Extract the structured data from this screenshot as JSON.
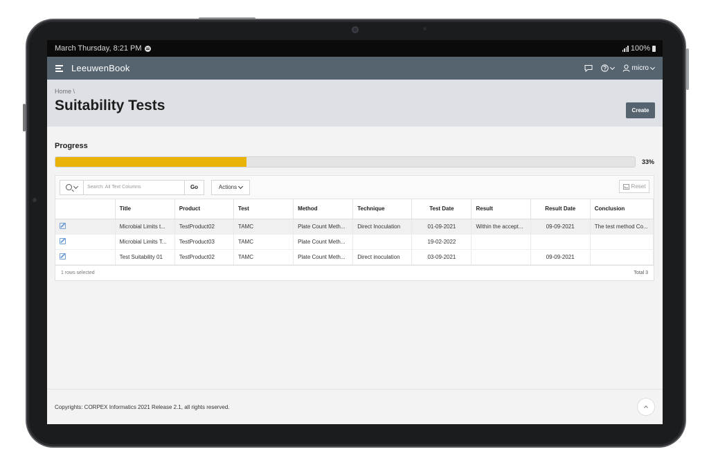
{
  "status_bar": {
    "datetime": "March Thursday, 8:21 PM",
    "battery": "100%"
  },
  "app": {
    "name": "LeeuwenBook",
    "user": "micro"
  },
  "breadcrumb": "Home \\",
  "page_title": "Suitability Tests",
  "create_label": "Create",
  "progress": {
    "label": "Progress",
    "percent_text": "33%",
    "value": 0.33,
    "bar_color": "#eab308"
  },
  "report": {
    "search_placeholder": "Search: All Text Columns",
    "go_label": "Go",
    "actions_label": "Actions",
    "reset_label": "Reset",
    "columns": [
      "Title",
      "Product",
      "Test",
      "Method",
      "Technique",
      "Test Date",
      "Result",
      "Result Date",
      "Conclusion"
    ],
    "rows": [
      [
        "Microbial Limits t...",
        "TestProduct02",
        "TAMC",
        "Plate Count Meth...",
        "Direct Inoculation",
        "01-09-2021",
        "Within the accept...",
        "09-09-2021",
        "The test method Co..."
      ],
      [
        "Microbial Limits T...",
        "TestProduct03",
        "TAMC",
        "Plate Count Meth...",
        "",
        "19-02-2022",
        "",
        "",
        ""
      ],
      [
        "Test Suitability 01",
        "TestProduct02",
        "TAMC",
        "Plate Count Meth...",
        "Direct inoculation",
        "03-09-2021",
        "",
        "09-09-2021",
        ""
      ]
    ],
    "selected_text": "1 rows selected",
    "total_text": "Total 3"
  },
  "footer_text": "Copyrights: CORPEX Informatics 2021 Release 2.1, all rights reserved.",
  "colors": {
    "header": "#56646f",
    "title_region": "#dde1e5",
    "accent": "#eab308"
  }
}
